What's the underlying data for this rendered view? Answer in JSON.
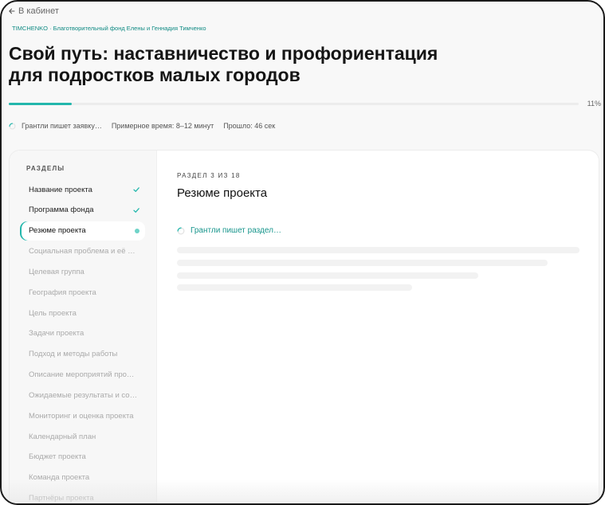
{
  "nav": {
    "back_label": "В кабинет"
  },
  "header": {
    "org": "TIMCHENKO · Благотворительный фонд Елены и Геннадия Тимченко",
    "title": "Свой путь: наставничество и профориентация для подростков малых городов"
  },
  "progress": {
    "value": 0.11,
    "label": "11%"
  },
  "status": {
    "writing": "Грантли пишет заявку…",
    "estimate": "Примерное время: 8–12 минут",
    "elapsed": "Прошло: 46 сек"
  },
  "sidebar": {
    "heading": "РАЗДЕЛЫ",
    "items": [
      {
        "label": "Название проекта",
        "state": "done"
      },
      {
        "label": "Программа фонда",
        "state": "done"
      },
      {
        "label": "Резюме проекта",
        "state": "active"
      },
      {
        "label": "Социальная проблема и её о…",
        "state": "pending"
      },
      {
        "label": "Целевая группа",
        "state": "pending"
      },
      {
        "label": "География проекта",
        "state": "pending"
      },
      {
        "label": "Цель проекта",
        "state": "pending"
      },
      {
        "label": "Задачи проекта",
        "state": "pending"
      },
      {
        "label": "Подход и методы работы",
        "state": "pending"
      },
      {
        "label": "Описание мероприятий про…",
        "state": "pending"
      },
      {
        "label": "Ожидаемые результаты и со…",
        "state": "pending"
      },
      {
        "label": "Мониторинг и оценка проекта",
        "state": "pending"
      },
      {
        "label": "Календарный план",
        "state": "pending"
      },
      {
        "label": "Бюджет проекта",
        "state": "pending"
      },
      {
        "label": "Команда проекта",
        "state": "pending"
      },
      {
        "label": "Партнёры проекта",
        "state": "pending"
      }
    ]
  },
  "main": {
    "counter": "РАЗДЕЛ 3 ИЗ 18",
    "section_title": "Резюме проекта",
    "writing": "Грантли пишет раздел…"
  },
  "colors": {
    "accent": "#23b7ac",
    "accent_text": "#17958c",
    "org_text": "#0f8a83"
  }
}
